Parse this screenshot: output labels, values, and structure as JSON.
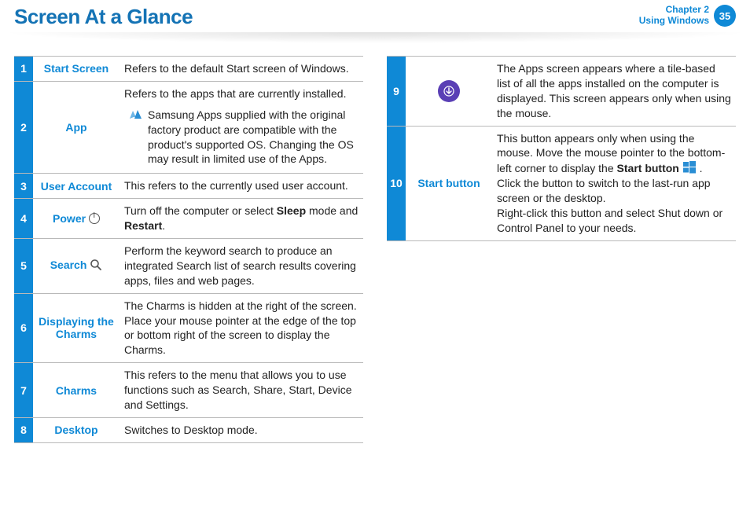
{
  "header": {
    "title": "Screen At a Glance",
    "chapter_line1": "Chapter 2",
    "chapter_line2": "Using Windows",
    "page_number": "35"
  },
  "left_rows": [
    {
      "num": "1",
      "label": "Start Screen",
      "icon": null,
      "desc_html": "Refers to the default Start screen of Windows."
    },
    {
      "num": "2",
      "label": "App",
      "icon": null,
      "desc_html": "Refers to the apps that are currently installed.",
      "note": "Samsung Apps supplied with the original factory product are compatible with the product's supported OS. Changing the OS may result in limited use of the Apps."
    },
    {
      "num": "3",
      "label": "User Account",
      "icon": null,
      "desc_html": "This refers to the currently used user account."
    },
    {
      "num": "4",
      "label": "Power",
      "icon": "power",
      "desc_html": "Turn off the computer or select <b>Sleep</b> mode and <b>Restart</b>."
    },
    {
      "num": "5",
      "label": "Search",
      "icon": "search",
      "desc_html": "Perform the keyword search to produce an integrated Search list of search results covering apps, files and web pages."
    },
    {
      "num": "6",
      "label": "Displaying the Charms",
      "icon": null,
      "desc_html": "The Charms is hidden at the right of the screen. Place your mouse pointer at the edge of the top or bottom right of the screen to display the Charms."
    },
    {
      "num": "7",
      "label": "Charms",
      "icon": null,
      "desc_html": "This refers to the menu that allows you to use functions such as Search, Share, Start, Device and Settings."
    },
    {
      "num": "8",
      "label": "Desktop",
      "icon": null,
      "desc_html": "Switches to Desktop mode."
    }
  ],
  "right_rows": [
    {
      "num": "9",
      "label_icon": "down-arrow",
      "desc_html": "The Apps screen appears where a tile-based list of all the apps installed on the computer is displayed. This screen appears only when using the mouse."
    },
    {
      "num": "10",
      "label": "Start button",
      "desc_html": "This button appears only when using the mouse. Move the mouse pointer to the bottom-left corner to display the <b>Start button</b> {{WIN}} .<br>Click the button to switch to the last-run app screen or the desktop.<br>Right-click this button and select Shut down or Control Panel to your needs."
    }
  ]
}
